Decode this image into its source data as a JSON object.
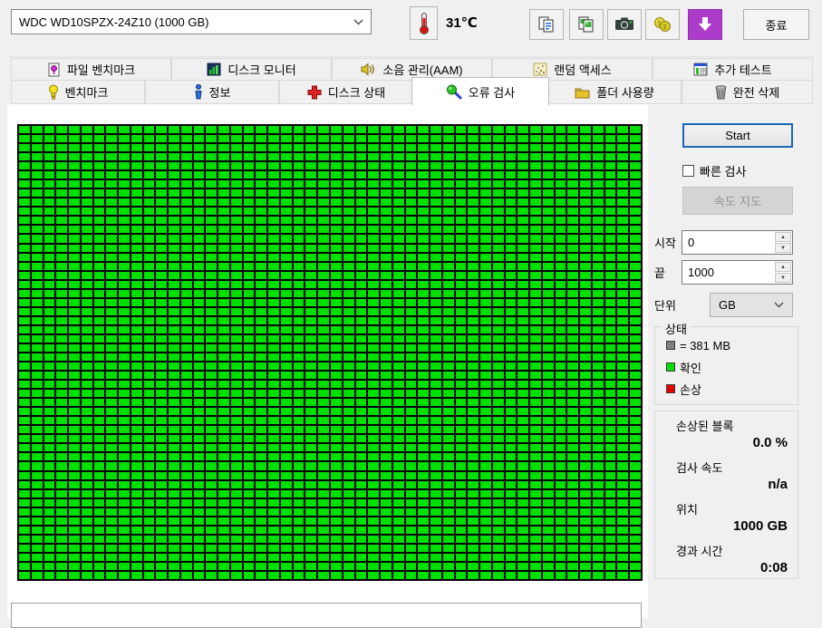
{
  "toolbar": {
    "device_select": {
      "value": "WDC WD10SPZX-24Z10 (1000 GB)"
    },
    "temperature": "31℃",
    "icons": [
      "thermometer-icon",
      "copy-text-icon",
      "copy-image-icon",
      "camera-icon",
      "donate-icon",
      "update-icon"
    ],
    "exit_label": "종료"
  },
  "tabs": {
    "row1": [
      {
        "label": "파일 벤치마크",
        "icon": "file-benchmark-icon"
      },
      {
        "label": "디스크 모니터",
        "icon": "disk-monitor-icon"
      },
      {
        "label": "소음 관리(AAM)",
        "icon": "speaker-icon"
      },
      {
        "label": "랜덤 액세스",
        "icon": "random-access-icon"
      },
      {
        "label": "추가 테스트",
        "icon": "extra-tests-icon"
      }
    ],
    "row2": [
      {
        "label": "벤치마크",
        "icon": "lightbulb-icon"
      },
      {
        "label": "정보",
        "icon": "info-icon"
      },
      {
        "label": "디스크 상태",
        "icon": "health-cross-icon"
      },
      {
        "label": "오류 검사",
        "icon": "magnifier-icon",
        "active": true
      },
      {
        "label": "폴더 사용량",
        "icon": "folder-icon"
      },
      {
        "label": "완전 삭제",
        "icon": "trash-icon"
      }
    ]
  },
  "scan_panel": {
    "start_button": "Start",
    "quick_scan_label": "빠른 검사",
    "quick_scan_checked": false,
    "speed_map_button": "속도 지도",
    "start_label": "시작",
    "start_value": "0",
    "end_label": "끝",
    "end_value": "1000",
    "unit_label": "단위",
    "unit_value": "GB",
    "status_group": {
      "title": "상태",
      "legend": [
        {
          "color": "#808080",
          "label": "= 381 MB"
        },
        {
          "color": "#00e000",
          "label": "확인"
        },
        {
          "color": "#e00000",
          "label": "손상"
        }
      ]
    },
    "stats": [
      {
        "label": "손상된 블록",
        "value": "0.0 %"
      },
      {
        "label": "검사 속도",
        "value": "n/a"
      },
      {
        "label": "위치",
        "value": "1000 GB"
      },
      {
        "label": "경과 시간",
        "value": "0:08"
      }
    ]
  },
  "block_map": {
    "type": "heatmap",
    "cols": 50,
    "rows": 50,
    "block_size_label": "= 381 MB",
    "ok_color": "#00e000",
    "damaged_color": "#e00000",
    "grid_line_color": "#000000",
    "all_blocks_status": "ok"
  },
  "colors": {
    "accent_blue": "#1a66b8",
    "update_button_purple": "#ad3bc9",
    "window_bg": "#f0f0f0"
  }
}
